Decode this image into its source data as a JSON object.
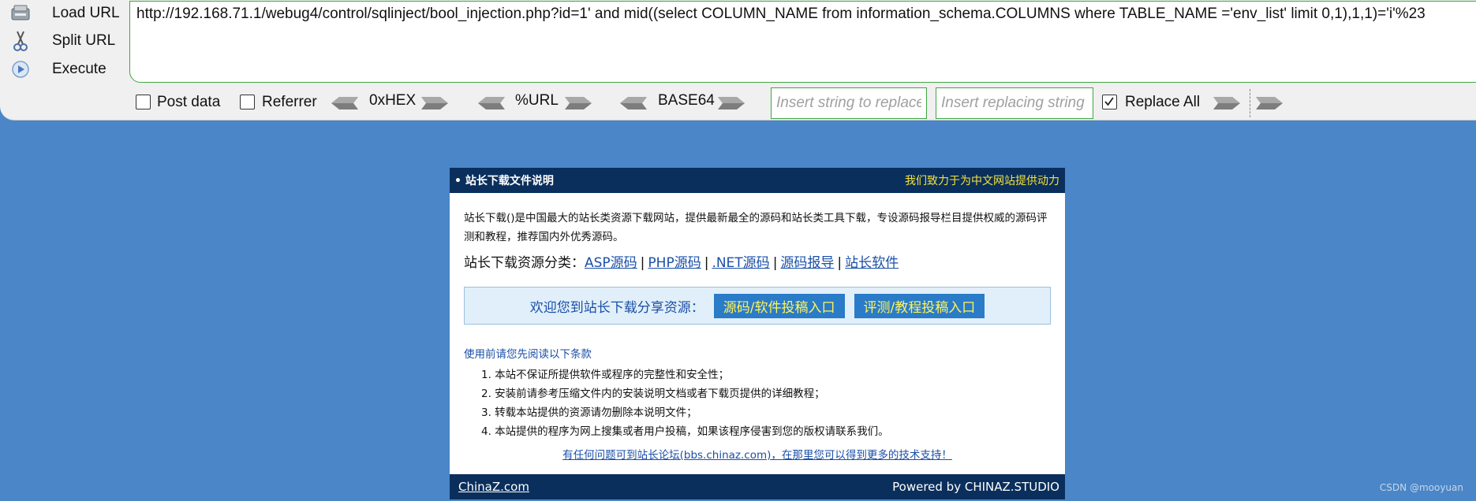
{
  "hackbar": {
    "load_url": "Load URL",
    "split_url": "Split URL",
    "execute": "Execute",
    "url_value": "http://192.168.71.1/webug4/control/sqlinject/bool_injection.php?id=1' and mid((select COLUMN_NAME from information_schema.COLUMNS where TABLE_NAME ='env_list' limit 0,1),1,1)='i'%23",
    "post_data": "Post data",
    "referrer": "Referrer",
    "hex": "0xHEX",
    "url_enc": "%URL",
    "base64": "BASE64",
    "find_placeholder": "Insert string to replace",
    "replace_placeholder": "Insert replacing string",
    "replace_all": "Replace All",
    "replace_all_checked": true
  },
  "card": {
    "title": "• 站长下载文件说明",
    "slogan": "我们致力于为中文网站提供动力",
    "intro": "站长下载()是中国最大的站长类资源下载网站，提供最新最全的源码和站长类工具下载，专设源码报导栏目提供权威的源码评测和教程，推荐国内外优秀源码。",
    "cats_label": "站长下载资源分类：",
    "cats": [
      "ASP源码",
      "PHP源码",
      ".NET源码",
      "源码报导",
      "站长软件"
    ],
    "sep": "|",
    "welcome": "欢迎您到站长下载分享资源：",
    "btn1": "源码/软件投稿入口",
    "btn2": "评测/教程投稿入口",
    "terms_title": "使用前请您先阅读以下条款",
    "terms": [
      "1. 本站不保证所提供软件或程序的完整性和安全性；",
      "2. 安装前请参考压缩文件内的安装说明文档或者下载页提供的详细教程；",
      "3. 转载本站提供的资源请勿删除本说明文件；",
      "4. 本站提供的程序为网上搜集或者用户投稿，如果该程序侵害到您的版权请联系我们。"
    ],
    "forum": "有任何问题可到站长论坛(bbs.chinaz.com)，在那里您可以得到更多的技术支持！",
    "foot_left": "ChinaZ.com",
    "foot_right": "Powered by CHINAZ.STUDIO"
  },
  "watermark": "CSDN @mooyuan"
}
